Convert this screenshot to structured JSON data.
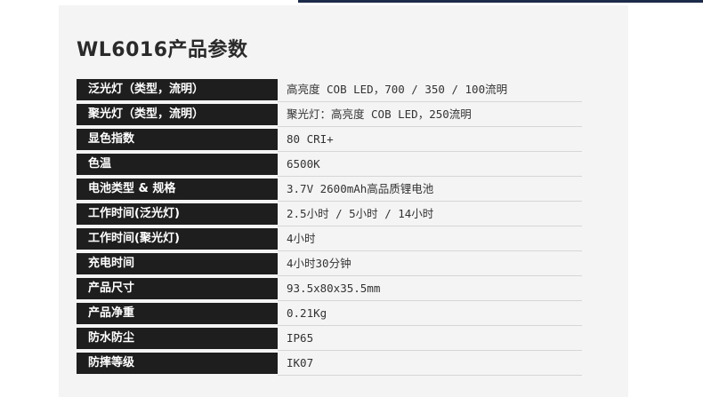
{
  "page": {
    "title": "WL6016产品参数"
  },
  "specs": [
    {
      "label": "泛光灯（类型，流明）",
      "value": "高亮度 COB LED，700 / 350 / 100流明"
    },
    {
      "label": "聚光灯（类型，流明）",
      "value": "聚光灯：高亮度 COB LED，250流明"
    },
    {
      "label": "显色指数",
      "value": "80 CRI+"
    },
    {
      "label": "色温",
      "value": "6500K"
    },
    {
      "label": "电池类型 & 规格",
      "value": "3.7V 2600mAh高品质锂电池"
    },
    {
      "label": "工作时间(泛光灯)",
      "value": "2.5小时 / 5小时 / 14小时"
    },
    {
      "label": "工作时间(聚光灯)",
      "value": "4小时"
    },
    {
      "label": "充电时间",
      "value": "4小时30分钟"
    },
    {
      "label": "产品尺寸",
      "value": "93.5x80x35.5mm"
    },
    {
      "label": "产品净重",
      "value": "0.21Kg"
    },
    {
      "label": "防水防尘",
      "value": "IP65"
    },
    {
      "label": "防摔等级",
      "value": "IK07"
    }
  ]
}
